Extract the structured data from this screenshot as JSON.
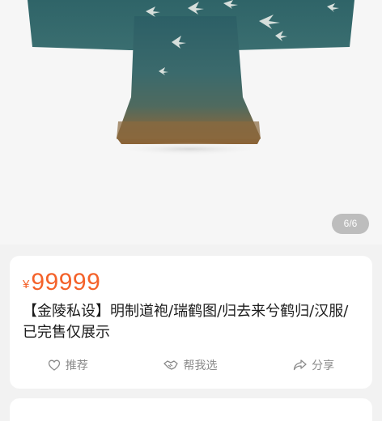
{
  "gallery": {
    "page_indicator": "6/6"
  },
  "product": {
    "currency_symbol": "¥",
    "price": "99999",
    "title": "【金陵私设】明制道袍/瑞鹤图/归去来兮鹤归/汉服/已完售仅展示",
    "actions": [
      {
        "label": "推荐",
        "icon": "heart-icon"
      },
      {
        "label": "帮我选",
        "icon": "handshake-icon"
      },
      {
        "label": "分享",
        "icon": "share-icon"
      }
    ]
  },
  "next_card": {
    "text": "……"
  },
  "colors": {
    "price_accent": "#f4622a",
    "robe_teal": "#2f6468",
    "robe_hem": "#8a6a3e"
  }
}
